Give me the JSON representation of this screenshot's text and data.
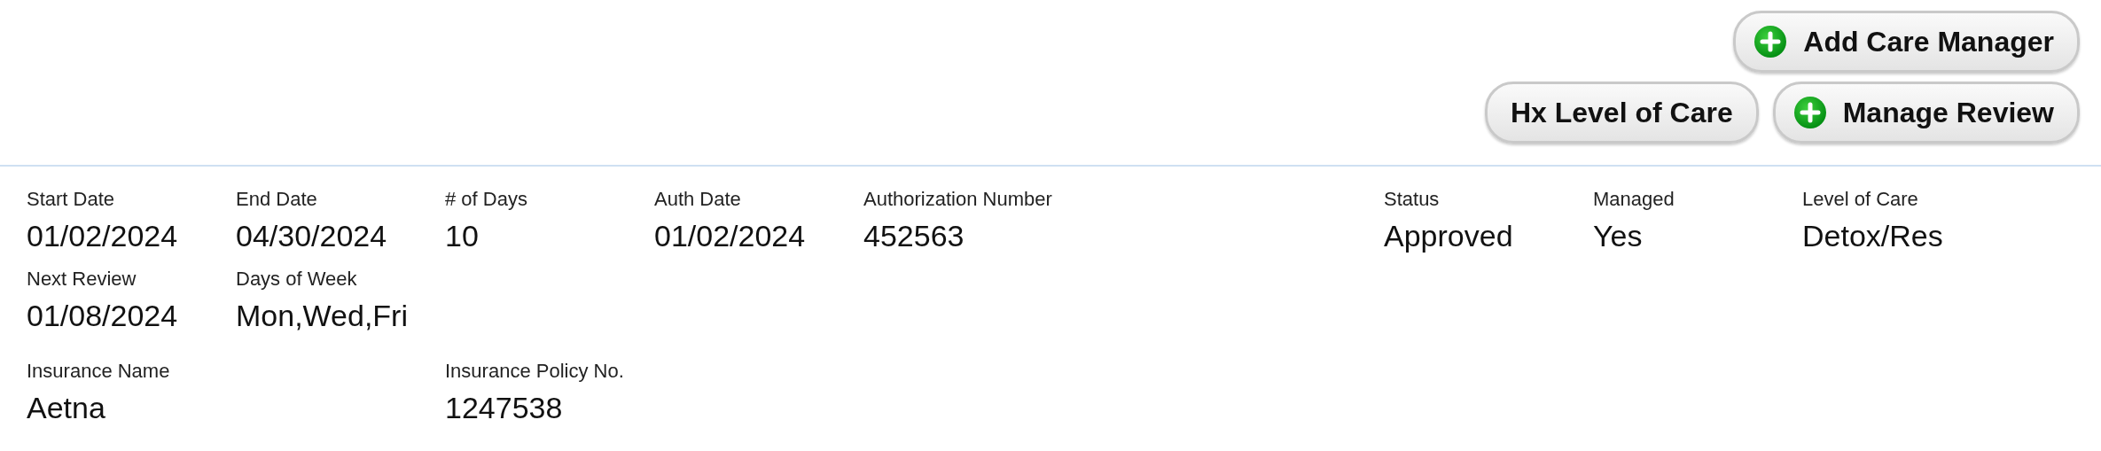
{
  "toolbar": {
    "buttons": [
      {
        "label": "Add Care Manager",
        "kind": "add"
      },
      {
        "label": "Hx Level of Care",
        "kind": "plain"
      },
      {
        "label": "Manage Review",
        "kind": "add"
      }
    ]
  },
  "details": {
    "rows": [
      {
        "left": [
          {
            "label": "Start Date",
            "value": "01/02/2024"
          },
          {
            "label": "End Date",
            "value": "04/30/2024"
          },
          {
            "label": "# of Days",
            "value": "10"
          },
          {
            "label": "Auth Date",
            "value": "01/02/2024"
          },
          {
            "label": "Authorization Number",
            "value": "452563"
          }
        ],
        "right": [
          {
            "label": "Status",
            "value": "Approved"
          },
          {
            "label": "Managed",
            "value": "Yes"
          },
          {
            "label": "Level of Care",
            "value": "Detox/Res"
          }
        ]
      },
      {
        "left": [
          {
            "label": "Next Review",
            "value": "01/08/2024"
          },
          {
            "label": "Days of Week",
            "value": "Mon,Wed,Fri"
          }
        ]
      },
      {
        "left": [
          {
            "label": "Insurance Name",
            "value": "Aetna"
          },
          {
            "label": "Insurance Policy No.",
            "value": "1247538"
          }
        ]
      }
    ]
  }
}
